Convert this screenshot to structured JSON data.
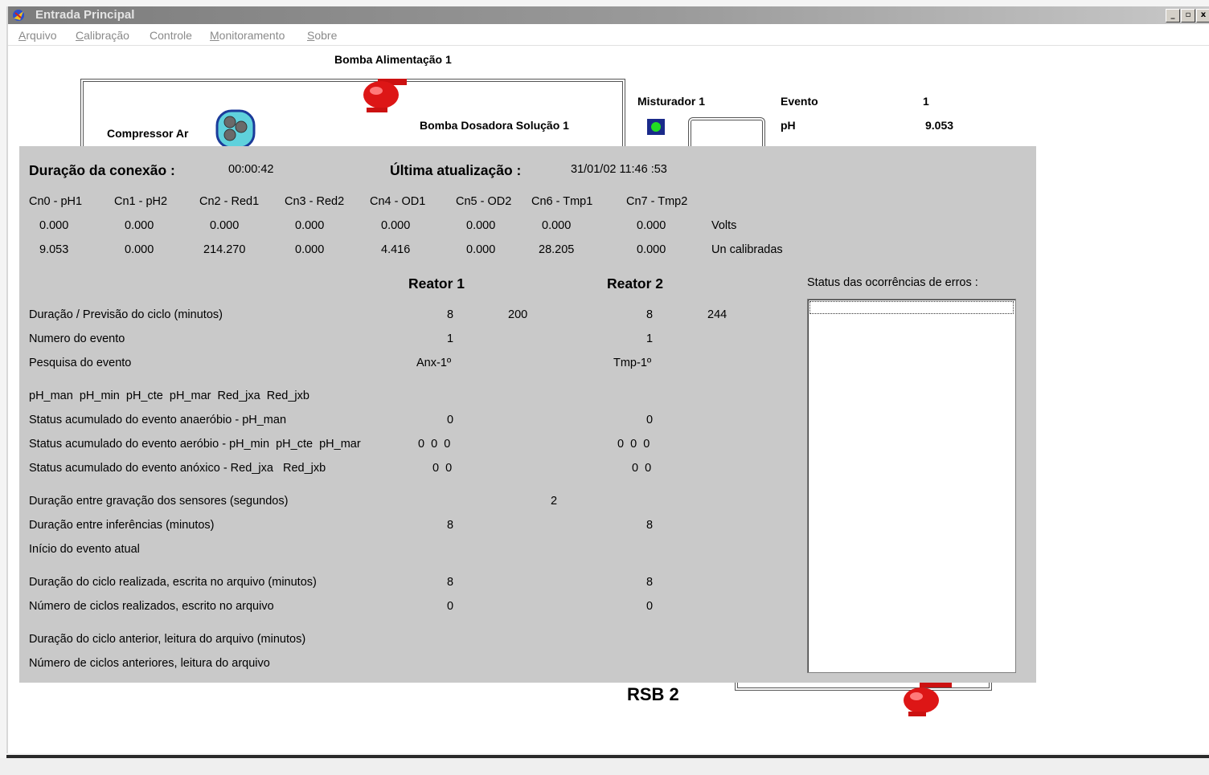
{
  "window": {
    "title": "Entrada Principal",
    "buttons": [
      "_",
      "▫",
      "x"
    ]
  },
  "menu": [
    {
      "first": "A",
      "rest": "rquivo"
    },
    {
      "first": "C",
      "rest": "alibração"
    },
    {
      "first": "C",
      "rest": "ontrole",
      "pre": ""
    },
    {
      "first": "M",
      "rest": "onitoramento"
    },
    {
      "first": "S",
      "rest": "obre"
    }
  ],
  "diagram": {
    "pump_feed_label": "Bomba Alimentação 1",
    "compressor_label": "Compressor Ar",
    "dosing_pump_label": "Bomba Dosadora Solução 1",
    "mixer_label": "Misturador 1",
    "event_label": "Evento",
    "event_value": "1",
    "ph_label": "pH",
    "ph_value": "9.053",
    "rsb_label": "RSB 2"
  },
  "panel": {
    "conn_duration_label": "Duração da conexão :",
    "conn_duration_value": "00:00:42",
    "last_update_label": "Última atualização :",
    "last_update_value": "31/01/02 11:46 :53",
    "channels": [
      {
        "name": "Cn0 - pH1",
        "volts": "0.000",
        "calibrated": "9.053"
      },
      {
        "name": "Cn1 - pH2",
        "volts": "0.000",
        "calibrated": "0.000"
      },
      {
        "name": "Cn2 - Red1",
        "volts": "0.000",
        "calibrated": "214.270"
      },
      {
        "name": "Cn3 - Red2",
        "volts": "0.000",
        "calibrated": "0.000"
      },
      {
        "name": "Cn4 - OD1",
        "volts": "0.000",
        "calibrated": "4.416"
      },
      {
        "name": "Cn5 - OD2",
        "volts": "0.000",
        "calibrated": "0.000"
      },
      {
        "name": "Cn6 - Tmp1",
        "volts": "0.000",
        "calibrated": "28.205"
      },
      {
        "name": "Cn7 - Tmp2",
        "volts": "0.000",
        "calibrated": "0.000"
      }
    ],
    "volts_unit": "Volts",
    "calibrated_unit": "Un calibradas",
    "reactor1_header": "Reator 1",
    "reactor2_header": "Reator 2",
    "error_status_label": "Status das ocorrências de erros :",
    "rows": [
      {
        "label": "Duração / Previsão do ciclo (minutos)",
        "r1": "8",
        "r1b": "200",
        "r2": "8",
        "r2b": "244"
      },
      {
        "label": "Numero do evento",
        "r1": "1",
        "r1b": "",
        "r2": "1",
        "r2b": ""
      },
      {
        "label": "Pesquisa do evento",
        "r1": "Anx-1º",
        "r1b": "",
        "r2": "Tmp-1º",
        "r2b": ""
      },
      {
        "label": "pH_man  pH_min  pH_cte  pH_mar  Red_jxa  Red_jxb",
        "r1": "",
        "r1b": "",
        "r2": "",
        "r2b": ""
      },
      {
        "label": "Status acumulado do evento anaeróbio - pH_man",
        "r1": "0",
        "r1b": "",
        "r2": "0",
        "r2b": ""
      },
      {
        "label": "Status acumulado do evento aeróbio - pH_min  pH_cte  pH_mar",
        "r1": "0  0  0",
        "r1b": "",
        "r2": "0  0  0",
        "r2b": ""
      },
      {
        "label": "Status acumulado do evento anóxico - Red_jxa   Red_jxb",
        "r1": "0  0",
        "r1b": "",
        "r2": "0  0",
        "r2b": ""
      },
      {
        "label": "Duração entre gravação dos sensores  (segundos)",
        "r1": "",
        "r1b": "2",
        "r2": "",
        "r2b": ""
      },
      {
        "label": "Duração entre inferências (minutos)",
        "r1": "8",
        "r1b": "",
        "r2": "8",
        "r2b": ""
      },
      {
        "label": "Início do evento atual",
        "r1": "",
        "r1b": "",
        "r2": "",
        "r2b": ""
      },
      {
        "label": "Duração do ciclo realizada, escrita no arquivo (minutos)",
        "r1": "8",
        "r1b": "",
        "r2": "8",
        "r2b": ""
      },
      {
        "label": "Número de ciclos realizados, escrito no arquivo",
        "r1": "0",
        "r1b": "",
        "r2": "0",
        "r2b": ""
      },
      {
        "label": "Duração do ciclo anterior, leitura do arquivo (minutos)",
        "r1": "",
        "r1b": "",
        "r2": "",
        "r2b": ""
      },
      {
        "label": "Número de ciclos anteriores, leitura do arquivo",
        "r1": "",
        "r1b": "",
        "r2": "",
        "r2b": ""
      }
    ]
  }
}
